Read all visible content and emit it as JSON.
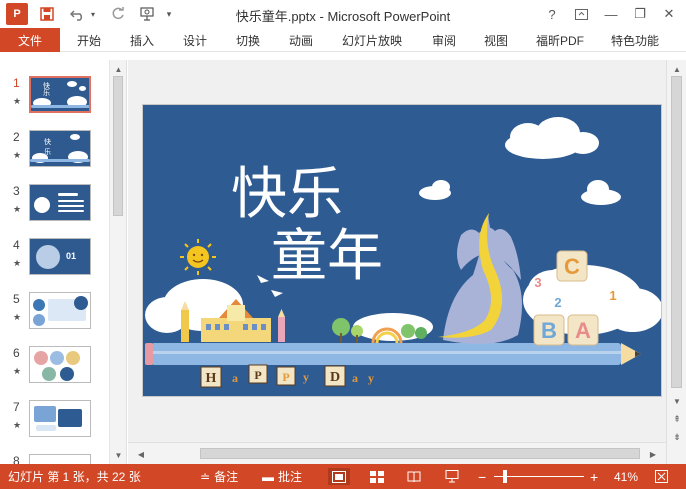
{
  "window": {
    "title": "快乐童年.pptx - Microsoft PowerPoint",
    "app_logo": "P",
    "help": "?",
    "ribbon_display_icon": "ribbon-display-icon",
    "minimize": "—",
    "restore": "❐",
    "close": "✕"
  },
  "quick_access": {
    "save_icon": "save-icon",
    "undo_icon": "undo-icon",
    "redo_icon": "redo-icon",
    "start_icon": "slideshow-from-start-icon",
    "customize_icon": "customize-icon"
  },
  "ribbon": {
    "file": "文件",
    "tabs": [
      "开始",
      "插入",
      "设计",
      "切换",
      "动画",
      "幻灯片放映",
      "审阅",
      "视图",
      "福昕PDF",
      "特色功能"
    ]
  },
  "thumbnails": [
    {
      "num": "1",
      "star": "★",
      "active": true
    },
    {
      "num": "2",
      "star": "★",
      "active": false
    },
    {
      "num": "3",
      "star": "★",
      "active": false
    },
    {
      "num": "4",
      "star": "★",
      "active": false
    },
    {
      "num": "5",
      "star": "★",
      "active": false
    },
    {
      "num": "6",
      "star": "★",
      "active": false
    },
    {
      "num": "7",
      "star": "★",
      "active": false
    },
    {
      "num": "8",
      "star": "★",
      "active": false
    }
  ],
  "slide": {
    "title_line1": "快乐",
    "title_line2": "童年",
    "letters": [
      "H",
      "a",
      "P",
      "P",
      "y"
    ],
    "letters2": [
      "D",
      "a",
      "y"
    ],
    "blocks": [
      "C",
      "B",
      "A"
    ],
    "numbers": [
      "3",
      "2",
      "1"
    ],
    "colors": {
      "background": "#2e5b91",
      "accent": "#d24726",
      "dino": "#a9b3d8",
      "spine": "#f2d43a",
      "pencil": "#8fb7e3"
    }
  },
  "status": {
    "slide_info": "幻灯片 第 1 张，共 22 张",
    "notes": "备注",
    "comments": "批注",
    "zoom_minus": "−",
    "zoom_plus": "+",
    "zoom": "41%"
  }
}
